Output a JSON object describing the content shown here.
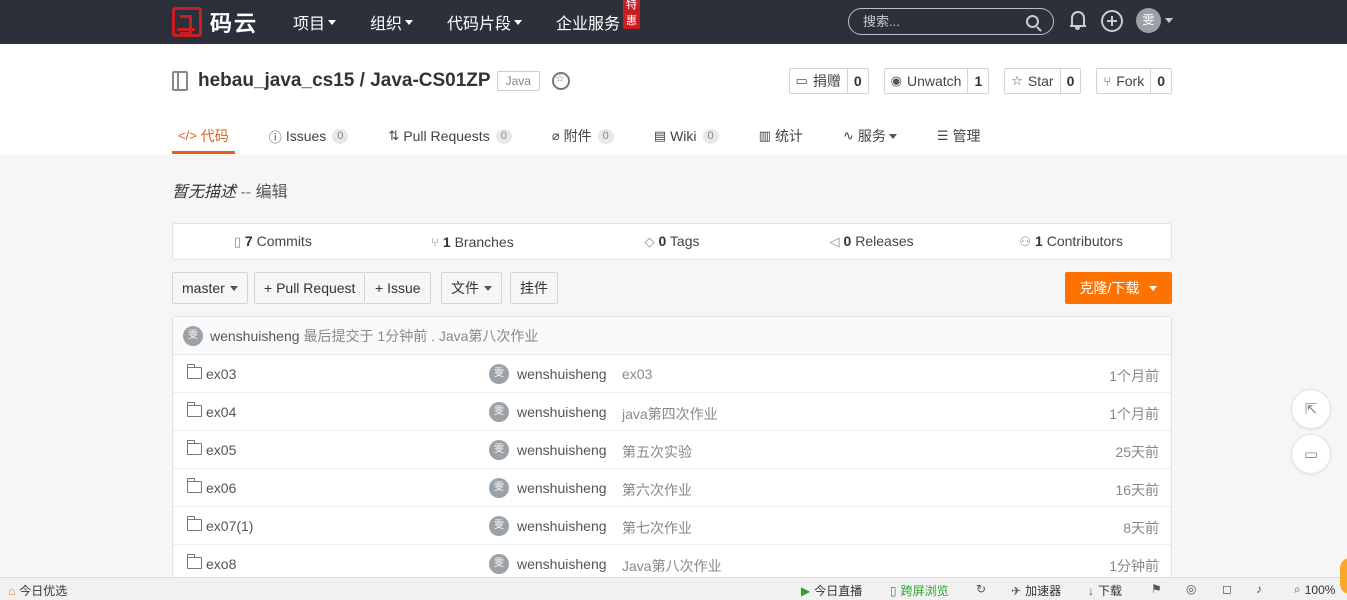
{
  "topnav": {
    "logo_text": "码云",
    "items": [
      {
        "label": "项目"
      },
      {
        "label": "组织"
      },
      {
        "label": "代码片段"
      },
      {
        "label": "企业服务"
      }
    ],
    "hot_badge": "特惠",
    "search_placeholder": "搜索...",
    "avatar_text": "雯"
  },
  "repo": {
    "owner": "hebau_java_cs15",
    "separator": " / ",
    "name": "Java-CS01ZP",
    "language": "Java",
    "buttons": [
      {
        "label": "捐赠",
        "count": "0"
      },
      {
        "label": "Unwatch",
        "count": "1"
      },
      {
        "label": "Star",
        "count": "0"
      },
      {
        "label": "Fork",
        "count": "0"
      }
    ],
    "tabs": [
      {
        "label": "代码",
        "count": ""
      },
      {
        "label": "Issues",
        "count": "0"
      },
      {
        "label": "Pull Requests",
        "count": "0"
      },
      {
        "label": "附件",
        "count": "0"
      },
      {
        "label": "Wiki",
        "count": "0"
      },
      {
        "label": "统计",
        "count": ""
      },
      {
        "label": "服务",
        "count": ""
      },
      {
        "label": "管理",
        "count": ""
      }
    ]
  },
  "description": {
    "text": "暂无描述",
    "sep": " -- ",
    "edit": "编辑"
  },
  "summary": [
    {
      "count": "7",
      "label": "Commits"
    },
    {
      "count": "1",
      "label": "Branches"
    },
    {
      "count": "0",
      "label": "Tags"
    },
    {
      "count": "0",
      "label": "Releases"
    },
    {
      "count": "1",
      "label": "Contributors"
    }
  ],
  "toolbar": {
    "branch": "master",
    "pull_request": "+ Pull Request",
    "issue": "+ Issue",
    "files": "文件",
    "widget": "挂件",
    "clone": "克隆/下载"
  },
  "last_commit": {
    "author": "wenshuisheng",
    "meta": "最后提交于 1分钟前 . Java第八次作业"
  },
  "files": [
    {
      "name": "ex03",
      "author": "wenshuisheng",
      "message": "ex03",
      "time": "1个月前"
    },
    {
      "name": "ex04",
      "author": "wenshuisheng",
      "message": "java第四次作业",
      "time": "1个月前"
    },
    {
      "name": "ex05",
      "author": "wenshuisheng",
      "message": "第五次实验",
      "time": "25天前"
    },
    {
      "name": "ex06",
      "author": "wenshuisheng",
      "message": "第六次作业",
      "time": "16天前"
    },
    {
      "name": "ex07(1)",
      "author": "wenshuisheng",
      "message": "第七次作业",
      "time": "8天前"
    },
    {
      "name": "exo8",
      "author": "wenshuisheng",
      "message": "Java第八次作业",
      "time": "1分钟前"
    }
  ],
  "statusbar": {
    "left": "今日优选",
    "live": "今日直播",
    "cross": "跨屏浏览",
    "accel": "加速器",
    "download": "下载",
    "zoom": "100%"
  },
  "colors": {
    "accent": "#e65f1e",
    "clone_button": "#fe7300",
    "topbar": "#2b303b"
  }
}
